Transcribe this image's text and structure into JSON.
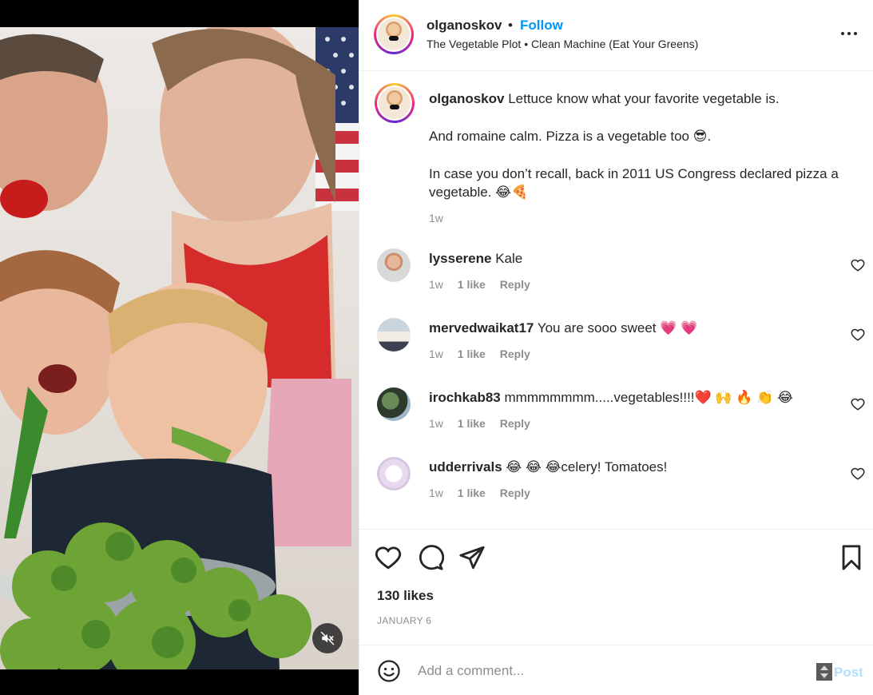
{
  "post": {
    "username": "olganoskov",
    "dot": "•",
    "follow_label": "Follow",
    "audio": "The Vegetable Plot • Clean Machine (Eat Your Greens)",
    "more_icon": "more-horizontal-icon",
    "mute_icon": "speaker-muted-icon"
  },
  "caption": {
    "username": "olganoskov",
    "line1": "Lettuce know what your favorite vegetable is.",
    "line2": "And romaine calm. Pizza is a vegetable too 😎.",
    "line3": "In case you don’t recall, back in 2011 US Congress declared pizza a vegetable. 😂🍕",
    "time": "1w"
  },
  "comments": [
    {
      "username": "lysserene",
      "text": "Kale",
      "time": "1w",
      "likes": "1 like",
      "reply": "Reply"
    },
    {
      "username": "mervedwaikat17",
      "text": "You are sooo sweet  💗 💗",
      "time": "1w",
      "likes": "1 like",
      "reply": "Reply"
    },
    {
      "username": "irochkab83",
      "text": "mmmmmmmm.....vegetables!!!!❤️ 🙌 🔥 👏 😂",
      "time": "1w",
      "likes": "1 like",
      "reply": "Reply"
    },
    {
      "username": "udderrivals",
      "text": "😂 😂 😂celery! Tomatoes!",
      "time": "1w",
      "likes": "1 like",
      "reply": "Reply"
    }
  ],
  "actions": {
    "likes": "130 likes",
    "date": "JANUARY 6"
  },
  "composer": {
    "placeholder": "Add a comment...",
    "post_label": "Post"
  },
  "colors": {
    "accent": "#0095f6",
    "post_disabled": "#b2dffc",
    "muted_text": "#8e8e8e"
  }
}
